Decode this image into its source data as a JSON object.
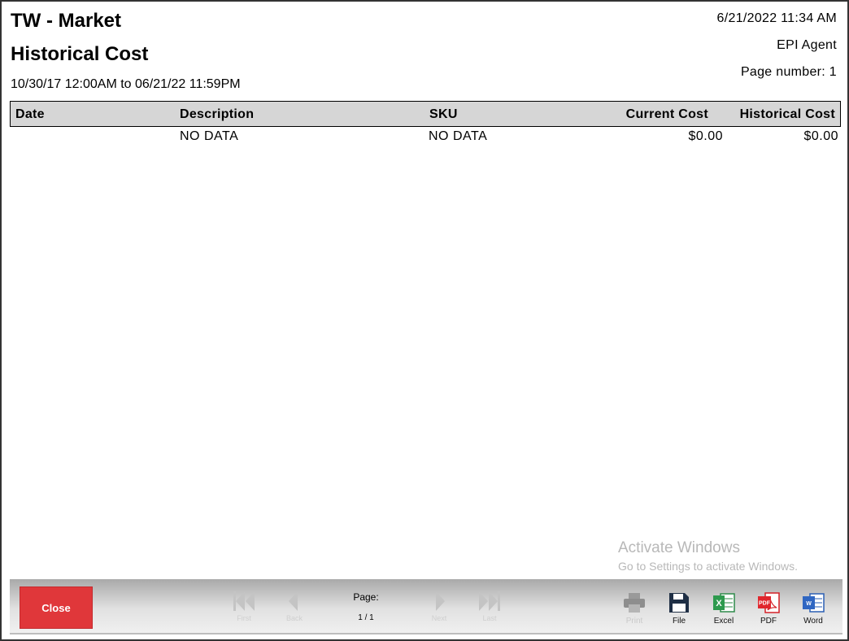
{
  "report": {
    "title": "TW - Market",
    "subtitle": "Historical Cost",
    "date_range": "10/30/17 12:00AM to 06/21/22 11:59PM",
    "generated": "6/21/2022 11:34 AM",
    "agent": "EPI Agent",
    "page_number": "Page number: 1"
  },
  "table": {
    "headers": [
      "Date",
      "Description",
      "SKU",
      "Current Cost",
      "Historical Cost"
    ],
    "rows": [
      {
        "date": "",
        "description": "NO DATA",
        "sku": "NO DATA",
        "current_cost": "$0.00",
        "historical_cost": "$0.00"
      }
    ]
  },
  "watermark": {
    "title": "Activate Windows",
    "subtitle": "Go to Settings to activate Windows."
  },
  "toolbar": {
    "close_label": "Close",
    "close_color": "#e0373a",
    "nav": {
      "first": "First",
      "back": "Back",
      "next": "Next",
      "last": "Last"
    },
    "page_label": "Page:",
    "page_value": "1 / 1",
    "tools": {
      "print": "Print",
      "file": "File",
      "excel": "Excel",
      "pdf": "PDF",
      "word": "Word"
    },
    "icons": [
      "first-page-icon",
      "previous-page-icon",
      "next-page-icon",
      "last-page-icon",
      "printer-icon",
      "save-file-icon",
      "excel-icon",
      "pdf-icon",
      "word-icon"
    ]
  }
}
